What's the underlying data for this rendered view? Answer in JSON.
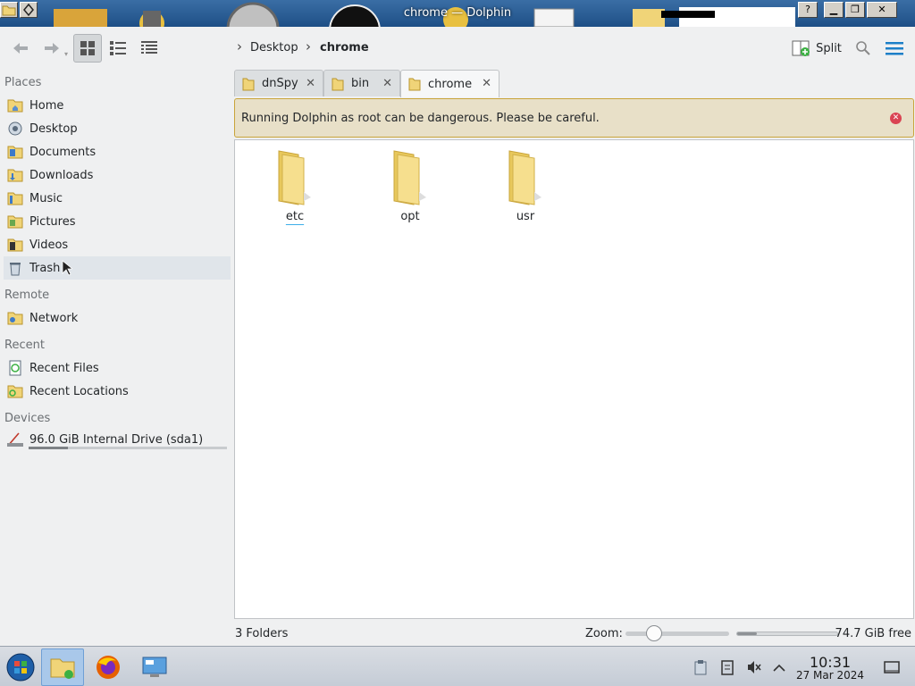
{
  "window": {
    "title": "chrome — Dolphin"
  },
  "toolbar": {
    "breadcrumb": [
      "Desktop",
      "chrome"
    ],
    "split_label": "Split"
  },
  "sidebar": {
    "sections": [
      {
        "heading": "Places",
        "items": [
          {
            "label": "Home",
            "icon": "home-folder-icon"
          },
          {
            "label": "Desktop",
            "icon": "desktop-icon"
          },
          {
            "label": "Documents",
            "icon": "documents-folder-icon"
          },
          {
            "label": "Downloads",
            "icon": "downloads-folder-icon"
          },
          {
            "label": "Music",
            "icon": "music-folder-icon"
          },
          {
            "label": "Pictures",
            "icon": "pictures-folder-icon"
          },
          {
            "label": "Videos",
            "icon": "videos-folder-icon"
          },
          {
            "label": "Trash",
            "icon": "trash-icon"
          }
        ]
      },
      {
        "heading": "Remote",
        "items": [
          {
            "label": "Network",
            "icon": "network-folder-icon"
          }
        ]
      },
      {
        "heading": "Recent",
        "items": [
          {
            "label": "Recent Files",
            "icon": "recent-files-icon"
          },
          {
            "label": "Recent Locations",
            "icon": "recent-locations-icon"
          }
        ]
      },
      {
        "heading": "Devices",
        "items": [
          {
            "label": "96.0 GiB Internal Drive (sda1)",
            "icon": "drive-icon",
            "usage_fraction": 0.2
          }
        ]
      }
    ]
  },
  "tabs": [
    {
      "label": "dnSpy"
    },
    {
      "label": "bin"
    },
    {
      "label": "chrome",
      "active": true
    }
  ],
  "warning": {
    "text": "Running Dolphin as root can be dangerous. Please be careful."
  },
  "content": {
    "items": [
      {
        "name": "etc",
        "type": "folder"
      },
      {
        "name": "opt",
        "type": "folder"
      },
      {
        "name": "usr",
        "type": "folder"
      }
    ]
  },
  "status": {
    "summary": "3 Folders",
    "zoom_label": "Zoom:",
    "zoom_fraction": 0.28,
    "free_space": "74.7 GiB free",
    "used_fraction": 0.2
  },
  "taskbar": {
    "time": "10:31",
    "date": "27 Mar 2024"
  },
  "colors": {
    "accent": "#3daee9",
    "folder": "#f0d478",
    "warning_bg": "#e8e0c8",
    "warning_border": "#c9a43a",
    "close_red": "#da4453"
  }
}
